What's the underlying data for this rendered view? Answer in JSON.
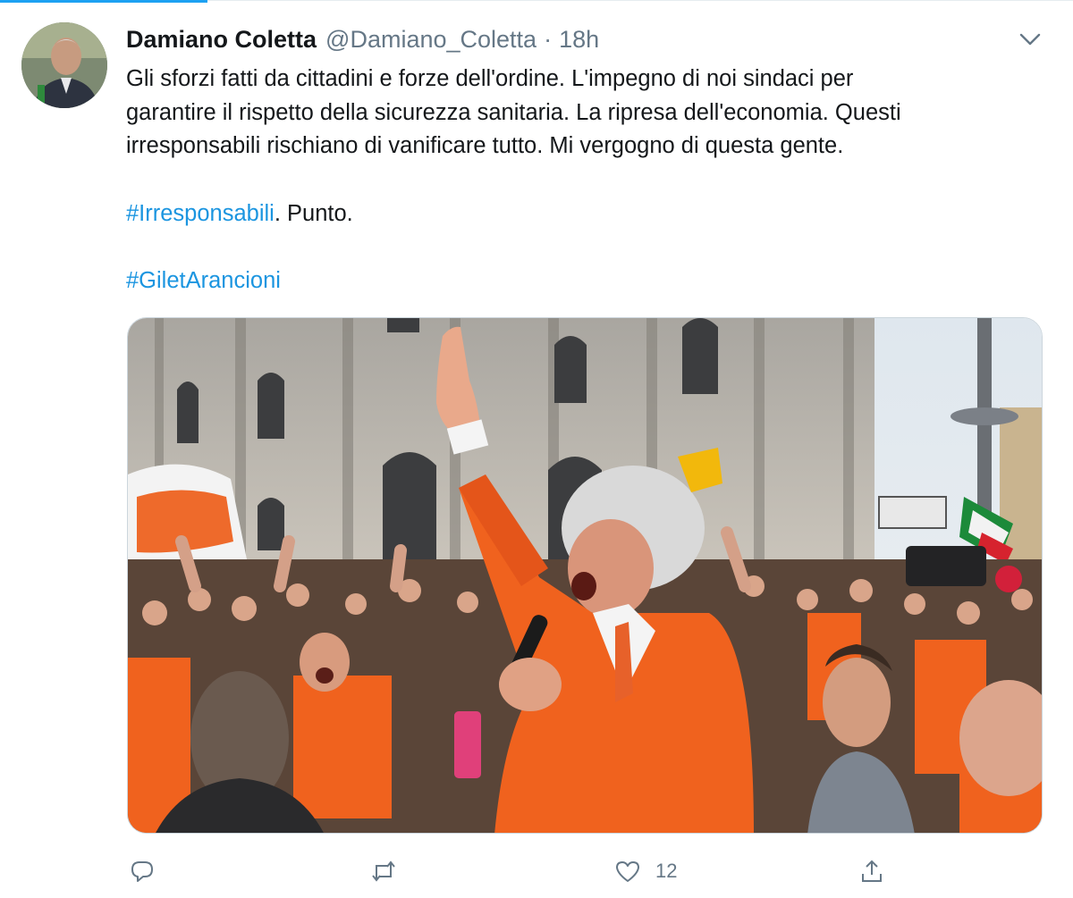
{
  "tweet": {
    "author_name": "Damiano Coletta",
    "author_handle": "@Damiano_Coletta",
    "separator": "·",
    "timestamp": "18h",
    "text_lines": [
      "Gli sforzi fatti da cittadini e forze dell'ordine. L'impegno di noi sindaci per",
      "garantire il rispetto della sicurezza sanitaria. La ripresa dell'economia. Questi",
      "irresponsabili rischiano di vanificare tutto. Mi vergogno di questa gente."
    ],
    "hashtag_1": "#Irresponsabili",
    "hashtag_1_suffix": ". Punto.",
    "hashtag_2": "#GiletArancioni"
  },
  "actions": {
    "reply_icon": "reply-icon",
    "retweet_icon": "retweet-icon",
    "like_icon": "heart-icon",
    "like_count": "12",
    "share_icon": "share-icon"
  },
  "colors": {
    "link": "#1b95e0",
    "muted": "#657786",
    "accent": "#1da1f2",
    "vest_orange": "#f0621e"
  }
}
